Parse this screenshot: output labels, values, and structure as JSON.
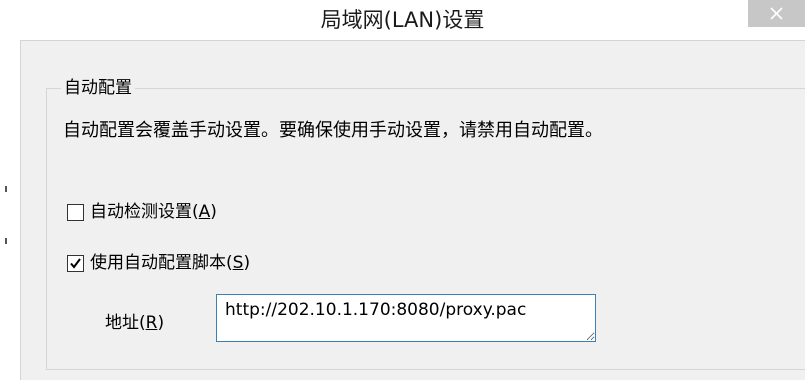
{
  "window": {
    "title": "局域网(LAN)设置",
    "close_glyph": "✕"
  },
  "auto_config": {
    "group_title": "自动配置",
    "description": "自动配置会覆盖手动设置。要确保使用手动设置，请禁用自动配置。",
    "auto_detect": {
      "label": "自动检测设置(",
      "accel": "A",
      "suffix": ")",
      "checked": false
    },
    "use_script": {
      "label": "使用自动配置脚本(",
      "accel": "S",
      "suffix": ")",
      "checked": true
    },
    "address": {
      "label": "地址(",
      "accel": "R",
      "suffix": ")",
      "value": "http://202.10.1.170:8080/proxy.pac"
    }
  }
}
